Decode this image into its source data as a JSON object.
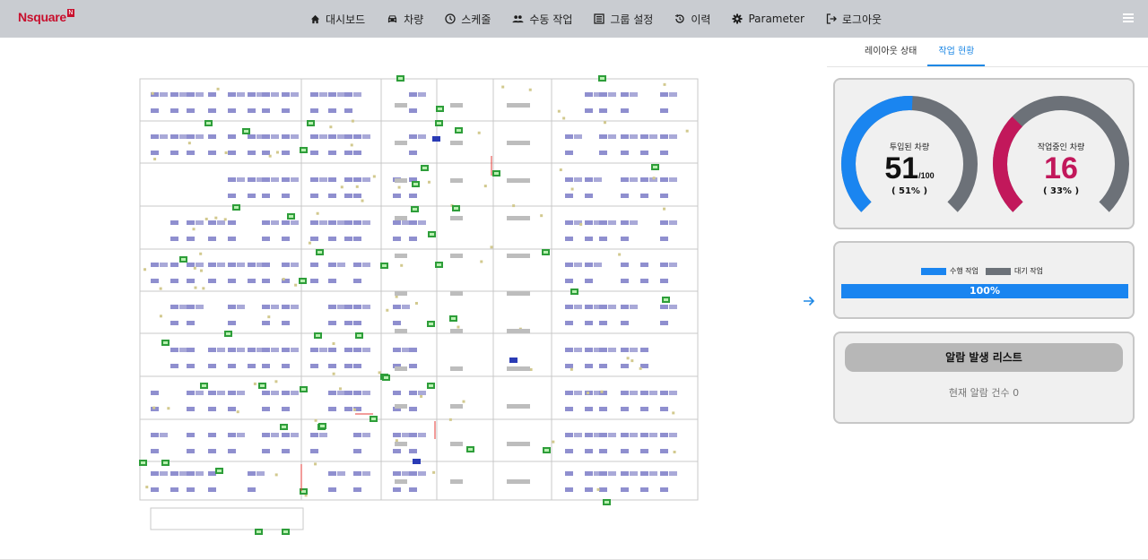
{
  "brand": {
    "name": "Nsquare",
    "badge": "N"
  },
  "nav": [
    {
      "label": "대시보드",
      "icon": "home-icon"
    },
    {
      "label": "차량",
      "icon": "car-icon"
    },
    {
      "label": "스케줄",
      "icon": "clock-icon"
    },
    {
      "label": "수동 작업",
      "icon": "people-icon"
    },
    {
      "label": "그룹 설정",
      "icon": "group-icon"
    },
    {
      "label": "이력",
      "icon": "history-icon"
    },
    {
      "label": "Parameter",
      "icon": "gear-icon"
    },
    {
      "label": "로그아웃",
      "icon": "logout-icon"
    }
  ],
  "tabs": [
    {
      "label": "레이아웃 상태",
      "active": false
    },
    {
      "label": "작업 현황",
      "active": true
    }
  ],
  "gauges": [
    {
      "label": "투입된 차량",
      "value": "51",
      "suffix": "/100",
      "percent_text": "( 51% )",
      "fraction": 0.51,
      "color": "#1a85f0",
      "value_color": "#111111"
    },
    {
      "label": "작업중인 차량",
      "value": "16",
      "suffix": "",
      "percent_text": "( 33% )",
      "fraction": 0.33,
      "color": "#c2185b",
      "value_color": "#c2185b"
    }
  ],
  "progress": {
    "legend": [
      {
        "label": "수행 작업",
        "color": "#1a85f0"
      },
      {
        "label": "대기 작업",
        "color": "#6c7178"
      }
    ],
    "label": "100%",
    "fraction": 1.0
  },
  "alarm": {
    "button_label": "알람 발생 리스트",
    "count_text": "현재 알람 건수 0"
  },
  "colors": {
    "topbar": "#c9ccd1",
    "accent": "#1e88e5",
    "brand": "#c8102e",
    "gauge_track": "#6c7178"
  }
}
